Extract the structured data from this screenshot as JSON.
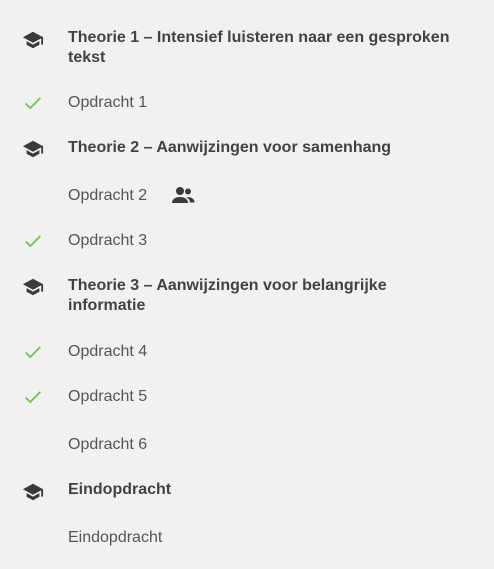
{
  "items": [
    {
      "type": "theory",
      "icon": "graduation-cap-icon",
      "label": "Theorie 1 – Intensief luisteren naar een gesproken",
      "label_line2": "tekst"
    },
    {
      "type": "assignment",
      "icon": "checkmark-icon",
      "completed": true,
      "label": "Opdracht 1"
    },
    {
      "type": "theory",
      "icon": "graduation-cap-icon",
      "label": "Theorie 2 – Aanwijzingen voor samenhang"
    },
    {
      "type": "assignment",
      "completed": false,
      "label": "Opdracht 2",
      "badge_icon": "group-icon"
    },
    {
      "type": "assignment",
      "icon": "checkmark-icon",
      "completed": true,
      "label": "Opdracht 3"
    },
    {
      "type": "theory",
      "icon": "graduation-cap-icon",
      "label": "Theorie 3 – Aanwijzingen voor belangrijke",
      "label_line2": "informatie"
    },
    {
      "type": "assignment",
      "icon": "checkmark-icon",
      "completed": true,
      "label": "Opdracht 4"
    },
    {
      "type": "assignment",
      "icon": "checkmark-icon",
      "completed": true,
      "label": "Opdracht 5"
    },
    {
      "type": "assignment",
      "completed": false,
      "label": "Opdracht 6"
    },
    {
      "type": "theory",
      "icon": "graduation-cap-icon",
      "label": "Eindopdracht"
    },
    {
      "type": "assignment",
      "completed": false,
      "label": "Eindopdracht"
    }
  ],
  "colors": {
    "background": "#f1f1f1",
    "check": "#7cc255",
    "theory_icon": "#3a3a3a",
    "theory_text": "#424242",
    "assignment_text": "#555555"
  }
}
